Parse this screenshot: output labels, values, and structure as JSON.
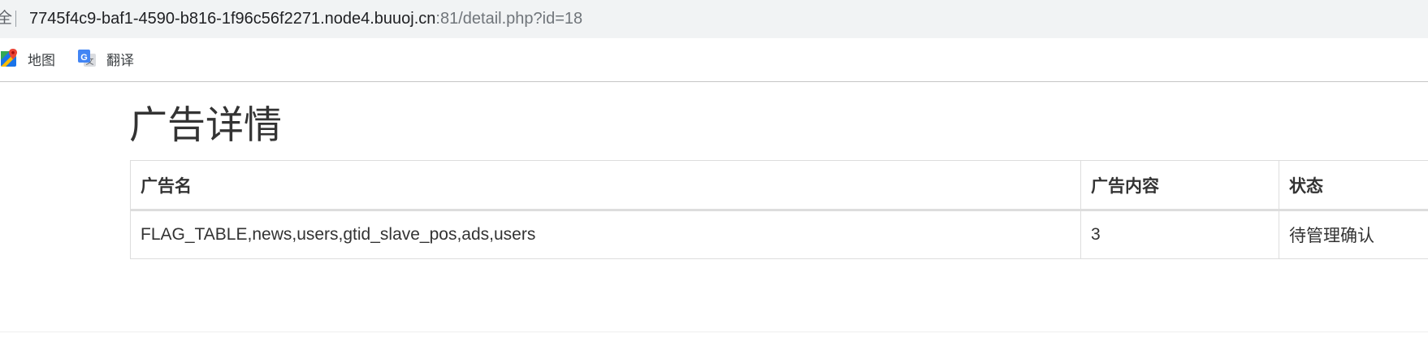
{
  "browser": {
    "address_lead": "全",
    "url_host": "7745f4c9-baf1-4590-b816-1f96c56f2271.node4.buuoj.cn",
    "url_rest": ":81/detail.php?id=18",
    "bookmarks": [
      {
        "label": "地图",
        "icon": "google-maps-icon"
      },
      {
        "label": "翻译",
        "icon": "google-translate-icon"
      }
    ]
  },
  "page": {
    "title": "广告详情",
    "table": {
      "headers": [
        "广告名",
        "广告内容",
        "状态"
      ],
      "rows": [
        [
          "FLAG_TABLE,news,users,gtid_slave_pos,ads,users",
          "3",
          "待管理确认"
        ]
      ]
    }
  },
  "colors": {
    "address_bar_bg": "#f1f3f4",
    "text": "#333333",
    "table_border": "#dddddd"
  }
}
